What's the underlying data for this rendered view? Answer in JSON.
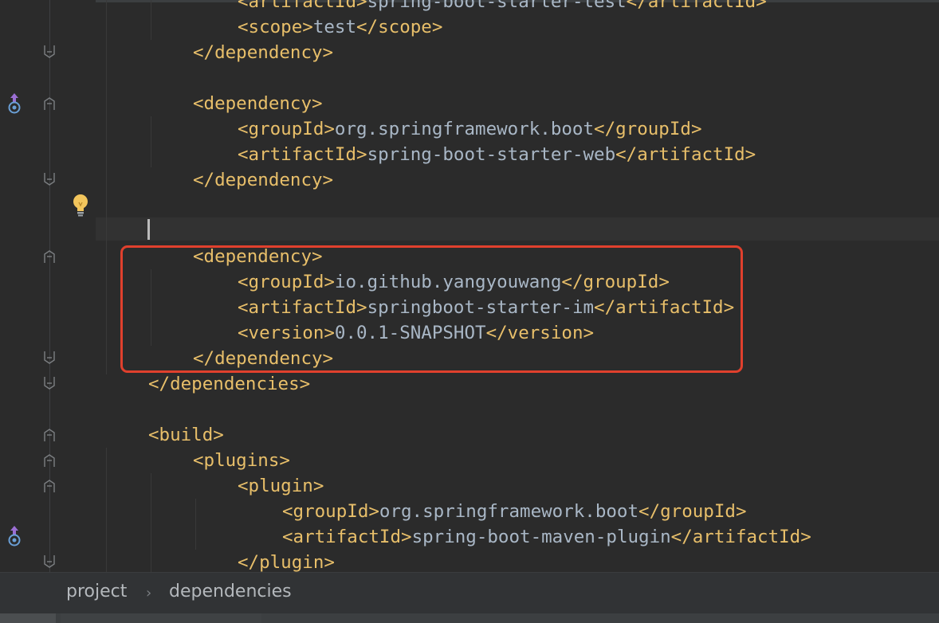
{
  "editor": {
    "lines": [
      {
        "parts": [
          [
            "tag",
            "<artifactId>"
          ],
          [
            "txt",
            "spring-boot-starter-test"
          ],
          [
            "tag",
            "</artifactId>"
          ]
        ]
      },
      {
        "parts": [
          [
            "tag",
            "<scope>"
          ],
          [
            "txt",
            "test"
          ],
          [
            "tag",
            "</scope>"
          ]
        ]
      },
      {
        "parts": [
          [
            "tag",
            "</dependency>"
          ]
        ]
      },
      {
        "parts": []
      },
      {
        "parts": [
          [
            "tag",
            "<dependency>"
          ]
        ]
      },
      {
        "parts": [
          [
            "tag",
            "<groupId>"
          ],
          [
            "txt",
            "org.springframework.boot"
          ],
          [
            "tag",
            "</groupId>"
          ]
        ]
      },
      {
        "parts": [
          [
            "tag",
            "<artifactId>"
          ],
          [
            "txt",
            "spring-boot-starter-web"
          ],
          [
            "tag",
            "</artifactId>"
          ]
        ]
      },
      {
        "parts": [
          [
            "tag",
            "</dependency>"
          ]
        ]
      },
      {
        "parts": []
      },
      {
        "parts": []
      },
      {
        "parts": [
          [
            "tag",
            "<dependency>"
          ]
        ]
      },
      {
        "parts": [
          [
            "tag",
            "<groupId>"
          ],
          [
            "txt",
            "io.github.yangyouwang"
          ],
          [
            "tag",
            "</groupId>"
          ]
        ]
      },
      {
        "parts": [
          [
            "tag",
            "<artifactId>"
          ],
          [
            "txt",
            "springboot-starter-im"
          ],
          [
            "tag",
            "</artifactId>"
          ]
        ]
      },
      {
        "parts": [
          [
            "tag",
            "<version>"
          ],
          [
            "txt",
            "0.0.1-SNAPSHOT"
          ],
          [
            "tag",
            "</version>"
          ]
        ]
      },
      {
        "parts": [
          [
            "tag",
            "</dependency>"
          ]
        ]
      },
      {
        "parts": [
          [
            "tag",
            "</dependencies>"
          ]
        ]
      },
      {
        "parts": []
      },
      {
        "parts": [
          [
            "tag",
            "<build>"
          ]
        ]
      },
      {
        "parts": [
          [
            "tag",
            "<plugins>"
          ]
        ]
      },
      {
        "parts": [
          [
            "tag",
            "<plugin>"
          ]
        ]
      },
      {
        "parts": [
          [
            "tag",
            "<groupId>"
          ],
          [
            "txt",
            "org.springframework.boot"
          ],
          [
            "tag",
            "</groupId>"
          ]
        ]
      },
      {
        "parts": [
          [
            "tag",
            "<artifactId>"
          ],
          [
            "txt",
            "spring-boot-maven-plugin"
          ],
          [
            "tag",
            "</artifactId>"
          ]
        ]
      },
      {
        "parts": [
          [
            "tag",
            "</plugin>"
          ]
        ]
      }
    ],
    "colors": {
      "tag": "#e8bf6a",
      "text": "#a9b7c6",
      "background": "#2b2b2b",
      "highlight_box": "#e0402d"
    }
  },
  "breadcrumb": {
    "items": [
      "project",
      "dependencies"
    ],
    "separator_icon": "chevron-right-icon"
  },
  "gutter_icons": {
    "override": "implemented-override-icon",
    "intention": "lightbulb-icon",
    "fold": "fold-marker-icon"
  }
}
